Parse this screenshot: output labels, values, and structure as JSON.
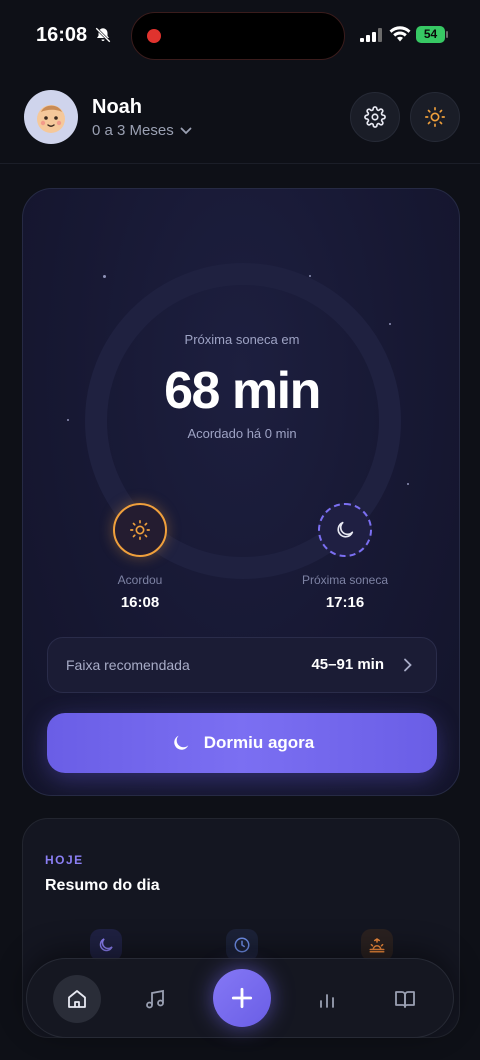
{
  "status_bar": {
    "time": "16:08",
    "battery": "54",
    "icons": [
      "bell-off-icon",
      "signal-icon",
      "wifi-icon",
      "battery-icon"
    ]
  },
  "header": {
    "baby_name": "Noah",
    "age_range": "0 a 3 Meses",
    "avatar_icon": "baby-face-icon",
    "settings_icon": "gear-icon",
    "theme_icon": "sun-icon"
  },
  "sleep_card": {
    "next_nap_label": "Próxima soneca em",
    "next_nap_value": "68 min",
    "awake_label": "Acordado há 0 min",
    "woke": {
      "caption": "Acordou",
      "time": "16:08",
      "icon": "sun-icon"
    },
    "next_nap": {
      "caption": "Próxima soneca",
      "time": "17:16",
      "icon": "moon-icon"
    },
    "recommended": {
      "label": "Faixa recomendada",
      "value": "45–91 min"
    },
    "action_button": "Dormiu agora"
  },
  "summary": {
    "eyebrow": "HOJE",
    "title": "Resumo do dia",
    "icons": [
      "moon-icon",
      "clock-icon",
      "sunrise-icon"
    ]
  },
  "bottom_nav": {
    "items": [
      "home-icon",
      "music-icon",
      "plus-icon",
      "stats-icon",
      "book-icon"
    ]
  },
  "colors": {
    "background": "#0e1017",
    "accent": "#7b6ff2",
    "sun": "#f0a03c"
  }
}
